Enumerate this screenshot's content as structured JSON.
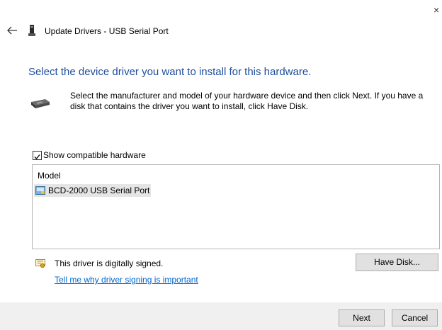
{
  "window": {
    "close_glyph": "×",
    "title": "Update Drivers - USB Serial Port"
  },
  "heading": "Select the device driver you want to install for this hardware.",
  "description": "Select the manufacturer and model of your hardware device and then click Next. If you have a disk that contains the driver you want to install, click Have Disk.",
  "compatible": {
    "label": "Show compatible hardware",
    "checked": true
  },
  "model_list": {
    "header": "Model",
    "items": [
      {
        "label": "BCD-2000 USB Serial Port",
        "selected": true
      }
    ]
  },
  "signing": {
    "status": "This driver is digitally signed.",
    "link": "Tell me why driver signing is important"
  },
  "buttons": {
    "have_disk": "Have Disk...",
    "next": "Next",
    "cancel": "Cancel"
  },
  "icons": {
    "back": "back-arrow-icon",
    "title": "usb-device-icon",
    "device": "hardware-device-icon",
    "item": "driver-package-icon",
    "signed": "signed-certificate-icon"
  },
  "colors": {
    "heading": "#1f4e9e",
    "link": "#0066cc",
    "footer_bg": "#f0f0f0",
    "selection_bg": "#e5e5e5"
  }
}
